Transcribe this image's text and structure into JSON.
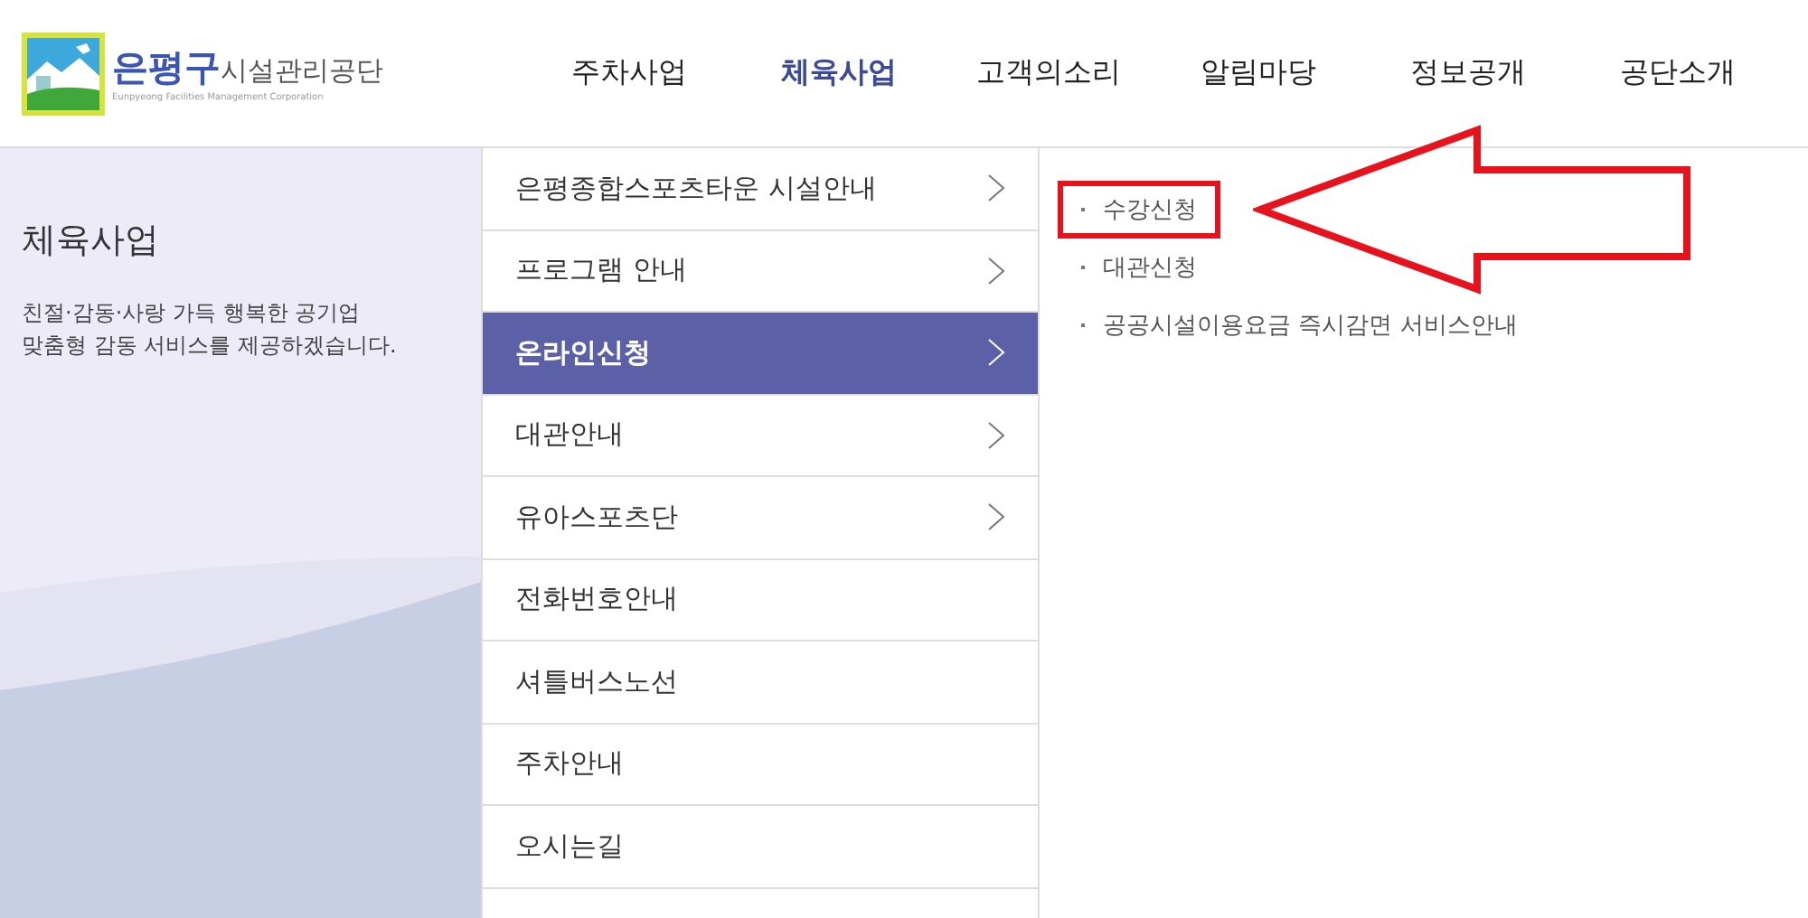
{
  "logo": {
    "name_accent": "은평구",
    "name": "시설관리공단",
    "subtitle": "Eunpyeong Facilities Management Corporation"
  },
  "nav": [
    {
      "label": "주차사업",
      "selected": false
    },
    {
      "label": "체육사업",
      "selected": true
    },
    {
      "label": "고객의소리",
      "selected": false
    },
    {
      "label": "알림마당",
      "selected": false
    },
    {
      "label": "정보공개",
      "selected": false
    },
    {
      "label": "공단소개",
      "selected": false
    }
  ],
  "section": {
    "title": "체육사업",
    "description": "친절·감동·사랑 가득 행복한 공기업\n맞춤형 감동 서비스를 제공하겠습니다."
  },
  "menu": [
    {
      "label": "은평종합스포츠타운 시설안내",
      "has_submenu": true,
      "selected": false
    },
    {
      "label": "프로그램 안내",
      "has_submenu": true,
      "selected": false
    },
    {
      "label": "온라인신청",
      "has_submenu": true,
      "selected": true
    },
    {
      "label": "대관안내",
      "has_submenu": true,
      "selected": false
    },
    {
      "label": "유아스포츠단",
      "has_submenu": true,
      "selected": false
    },
    {
      "label": "전화번호안내",
      "has_submenu": false,
      "selected": false
    },
    {
      "label": "셔틀버스노선",
      "has_submenu": false,
      "selected": false
    },
    {
      "label": "주차안내",
      "has_submenu": false,
      "selected": false
    },
    {
      "label": "오시는길",
      "has_submenu": false,
      "selected": false
    }
  ],
  "submenu": [
    {
      "label": "수강신청",
      "highlighted": true
    },
    {
      "label": "대관신청",
      "highlighted": false
    },
    {
      "label": "공공시설이용요금 즉시감면 서비스안내",
      "highlighted": false
    }
  ]
}
